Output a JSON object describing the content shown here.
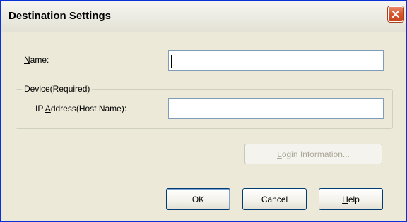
{
  "window": {
    "title": "Destination Settings"
  },
  "form": {
    "name_label_accesskey": "N",
    "name_label_rest": "ame:",
    "name_value": "",
    "device_group_label": "Device(Required)",
    "ip_label_prefix": "IP ",
    "ip_label_accesskey": "A",
    "ip_label_rest": "ddress(Host Name):",
    "ip_value": ""
  },
  "buttons": {
    "login_accesskey": "L",
    "login_rest": "ogin Information...",
    "ok_label": "OK",
    "cancel_label": "Cancel",
    "help_accesskey": "H",
    "help_rest": "elp"
  },
  "colors": {
    "face": "#ece9d8",
    "close_button": "#d9572f",
    "input_border": "#7f9db9",
    "disabled_text": "#aca899"
  },
  "icons": {
    "close": "close-icon"
  }
}
